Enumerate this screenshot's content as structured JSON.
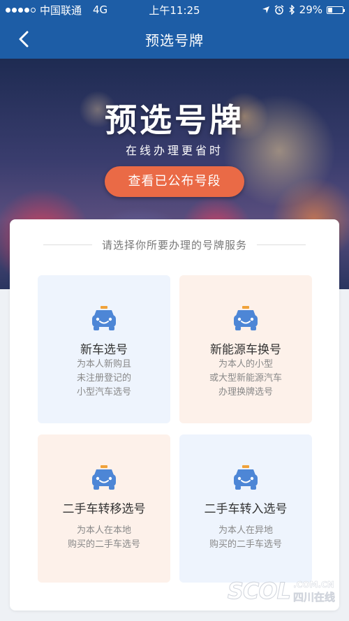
{
  "status_bar": {
    "carrier": "中国联通",
    "network": "4G",
    "time": "上午11:25",
    "battery_text": "29%",
    "battery_level": 0.29,
    "signal_strength": 4
  },
  "nav": {
    "title": "预选号牌",
    "back_icon": "chevron-left-icon"
  },
  "hero": {
    "title": "预选号牌",
    "subtitle": "在线办理更省时",
    "button_label": "查看已公布号段"
  },
  "panel": {
    "header": "请选择你所要办理的号牌服务"
  },
  "cards": [
    {
      "title": "新车选号",
      "desc": [
        "为本人新购且",
        "未注册登记的",
        "小型汽车选号"
      ],
      "icon": "car-icon"
    },
    {
      "title": "新能源车换号",
      "desc": [
        "为本人的小型",
        "或大型新能源汽车",
        "办理换牌选号"
      ],
      "icon": "car-icon"
    },
    {
      "title": "二手车转移选号",
      "desc": [
        "为本人在本地",
        "购买的二手车选号"
      ],
      "icon": "car-icon"
    },
    {
      "title": "二手车转入选号",
      "desc": [
        "为本人在异地",
        "购买的二手车选号"
      ],
      "icon": "car-icon"
    }
  ],
  "watermark": {
    "logo": "SCOL",
    "domain": ".COM.CN",
    "name": "四川在线"
  },
  "colors": {
    "nav_blue": "#1d5da6",
    "button_orange": "#ea6a46",
    "icon_blue": "#4d86d6",
    "card_blue_bg": "#eef4fd",
    "card_peach_bg": "#fdf1ea"
  }
}
